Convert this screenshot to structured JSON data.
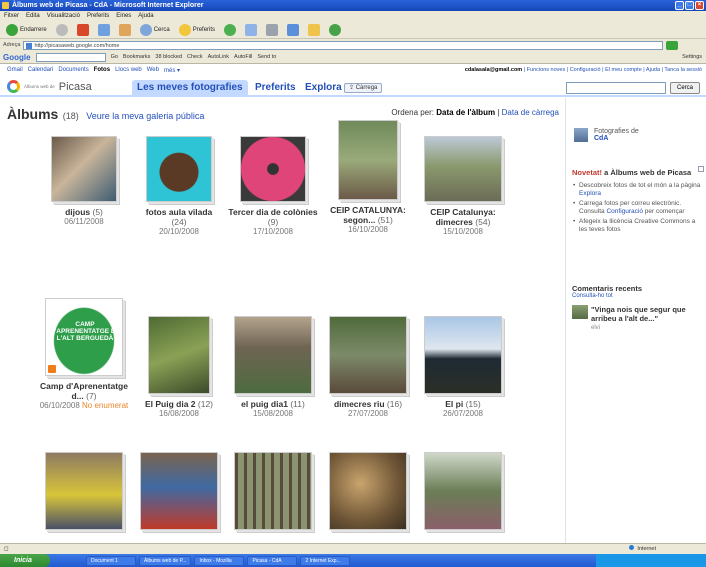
{
  "window": {
    "title": "Àlbums web de Picasa - CdA - Microsoft Internet Explorer"
  },
  "menu": [
    "Fitxer",
    "Edita",
    "Visualització",
    "Preferits",
    "Eines",
    "Ajuda"
  ],
  "toolbar": {
    "back": "Endarrere",
    "search": "Cerca",
    "favorites": "Preferits"
  },
  "address": {
    "label": "Adreça",
    "url": "http://picasaweb.google.com/home"
  },
  "google_toolbar": {
    "logo": "Google",
    "go": "Go",
    "bookmarks": "Bookmarks",
    "blocked": "38 blocked",
    "check": "Check",
    "autolink": "AutoLink",
    "autofill": "AutoFill",
    "send": "Send to",
    "settings": "Settings"
  },
  "topnav": {
    "items": [
      "Gmail",
      "Calendari",
      "Documents",
      "Fotos",
      "Llocs web",
      "Web",
      "més ▾"
    ],
    "account": "cdalasala@gmail.com",
    "links": "Funcions noves | Configuració | El meu compte | Ajuda | Tanca la sessió"
  },
  "brand": {
    "sub": "Àlbums web de",
    "word": "Picasa"
  },
  "tabs": [
    "Les meves fotografies",
    "Preferits",
    "Explora"
  ],
  "upload_label": "Càrrega",
  "search_button": "Cerca",
  "header": {
    "title": "Àlbums",
    "count": "(18)",
    "gallery_link": "Veure la meva galeria pública",
    "sort_label": "Ordena per:",
    "sort_active": "Data de l'àlbum",
    "sort_sep": "|",
    "sort_other": "Data de càrrega"
  },
  "albums": [
    {
      "title": "dijous",
      "count": "(5)",
      "date": "06/11/2008",
      "extra": ""
    },
    {
      "title": "fotos aula vilada",
      "count": "(24)",
      "date": "20/10/2008",
      "extra": ""
    },
    {
      "title": "Tercer dia de colònies",
      "count": "(9)",
      "date": "17/10/2008",
      "extra": ""
    },
    {
      "title": "CEIP CATALUNYA: segon...",
      "count": "(51)",
      "date": "16/10/2008",
      "extra": ""
    },
    {
      "title": "CEIP Catalunya: dimecres",
      "count": "(54)",
      "date": "15/10/2008",
      "extra": ""
    },
    {
      "title": "Camp d'Aprenentatge d...",
      "count": "(7)",
      "date": "06/10/2008",
      "extra": "No enumerat"
    },
    {
      "title": "El Puig dia 2",
      "count": "(12)",
      "date": "16/08/2008",
      "extra": ""
    },
    {
      "title": "el puig dia1",
      "count": "(11)",
      "date": "15/08/2008",
      "extra": ""
    },
    {
      "title": "dimecres riu",
      "count": "(16)",
      "date": "27/07/2008",
      "extra": ""
    },
    {
      "title": "El pi",
      "count": "(15)",
      "date": "26/07/2008",
      "extra": ""
    }
  ],
  "camp_sign": "CAMP D'APRENENTATGE DE L'ALT BERGUEDÀ",
  "sidebar": {
    "owner_label": "Fotografies de",
    "owner_name": "CdA",
    "news_red": "Novetat!",
    "news_rest": " a Àlbums web de Picasa",
    "news_items": [
      {
        "text": "Descobreix fotos de tot el món a la pàgina ",
        "link": "Explora"
      },
      {
        "text": "Carrega fotos per correu electrònic. Consulta ",
        "link": "Configuració",
        "tail": " per començar"
      },
      {
        "text": "Afegeix la llicència Creative Commons a les teves fotos",
        "link": ""
      }
    ],
    "comments_title": "Comentaris recents",
    "comments_link": "Consulta-ho tot",
    "comment_text": "\"Vinga nois que segur que arribeu a l'alt de...\"",
    "comment_author": "elvi"
  },
  "status": {
    "zone": "Internet"
  },
  "taskbar": {
    "start": "Inicia",
    "tasks": [
      "Document 1",
      "Àlbums web de P...",
      "Inbox - Mozilla",
      "Picasa - CdA",
      "2 Internet Exp..."
    ]
  }
}
